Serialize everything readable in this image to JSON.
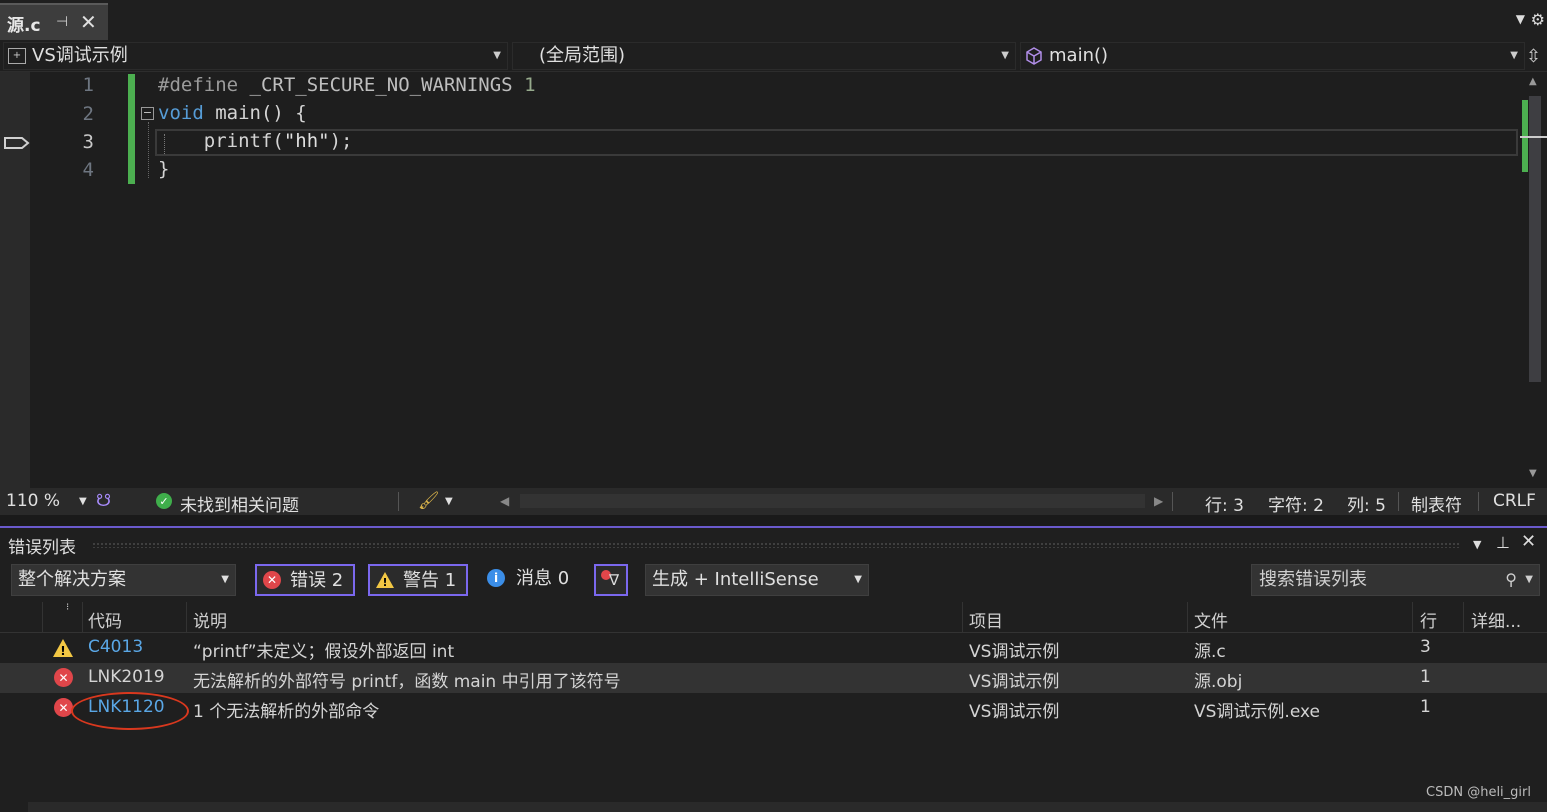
{
  "tab": {
    "name": "源.c",
    "pin": "⊣",
    "close": "✕"
  },
  "navbar": {
    "project": "VS调试示例",
    "scope": "(全局范围)",
    "function": "main()"
  },
  "editor": {
    "line_numbers": [
      "1",
      "2",
      "3",
      "4"
    ],
    "lines": [
      {
        "prefix": "#define ",
        "text": "_CRT_SECURE_NO_WARNINGS",
        "suffix": " 1"
      },
      {
        "keyword": "void",
        "text": " main() {"
      },
      {
        "text": "    printf(",
        "string": "\"hh\"",
        "suffix": ");"
      },
      {
        "text": "}"
      }
    ],
    "current_line": 3
  },
  "status": {
    "zoom": "110 %",
    "issues": "未找到相关问题",
    "line": "行: 3",
    "char": "字符: 2",
    "col": "列: 5",
    "tabs": "制表符",
    "eol": "CRLF"
  },
  "error_list": {
    "title": "错误列表",
    "scope_select": "整个解决方案",
    "errors_btn": "错误 2",
    "warnings_btn": "警告 1",
    "messages_btn": "消息 0",
    "source_select": "生成 + IntelliSense",
    "search_placeholder": "搜索错误列表",
    "columns": {
      "code": "代码",
      "desc": "说明",
      "project": "项目",
      "file": "文件",
      "line": "行",
      "detail": "详细..."
    },
    "rows": [
      {
        "type": "warning",
        "code": "C4013",
        "desc": "“printf”未定义；假设外部返回 int",
        "project": "VS调试示例",
        "file": "源.c",
        "line": "3"
      },
      {
        "type": "error",
        "code": "LNK2019",
        "desc": "无法解析的外部符号 printf，函数 main 中引用了该符号",
        "project": "VS调试示例",
        "file": "源.obj",
        "line": "1"
      },
      {
        "type": "error",
        "code": "LNK1120",
        "desc": "1 个无法解析的外部命令",
        "project": "VS调试示例",
        "file": "VS调试示例.exe",
        "line": "1"
      }
    ]
  },
  "watermark": "CSDN @heli_girl",
  "colors": {
    "accent": "#7b68ee",
    "error": "#e0464a",
    "warning": "#f2c744",
    "link": "#5aa7e6",
    "green": "#4caf50"
  }
}
